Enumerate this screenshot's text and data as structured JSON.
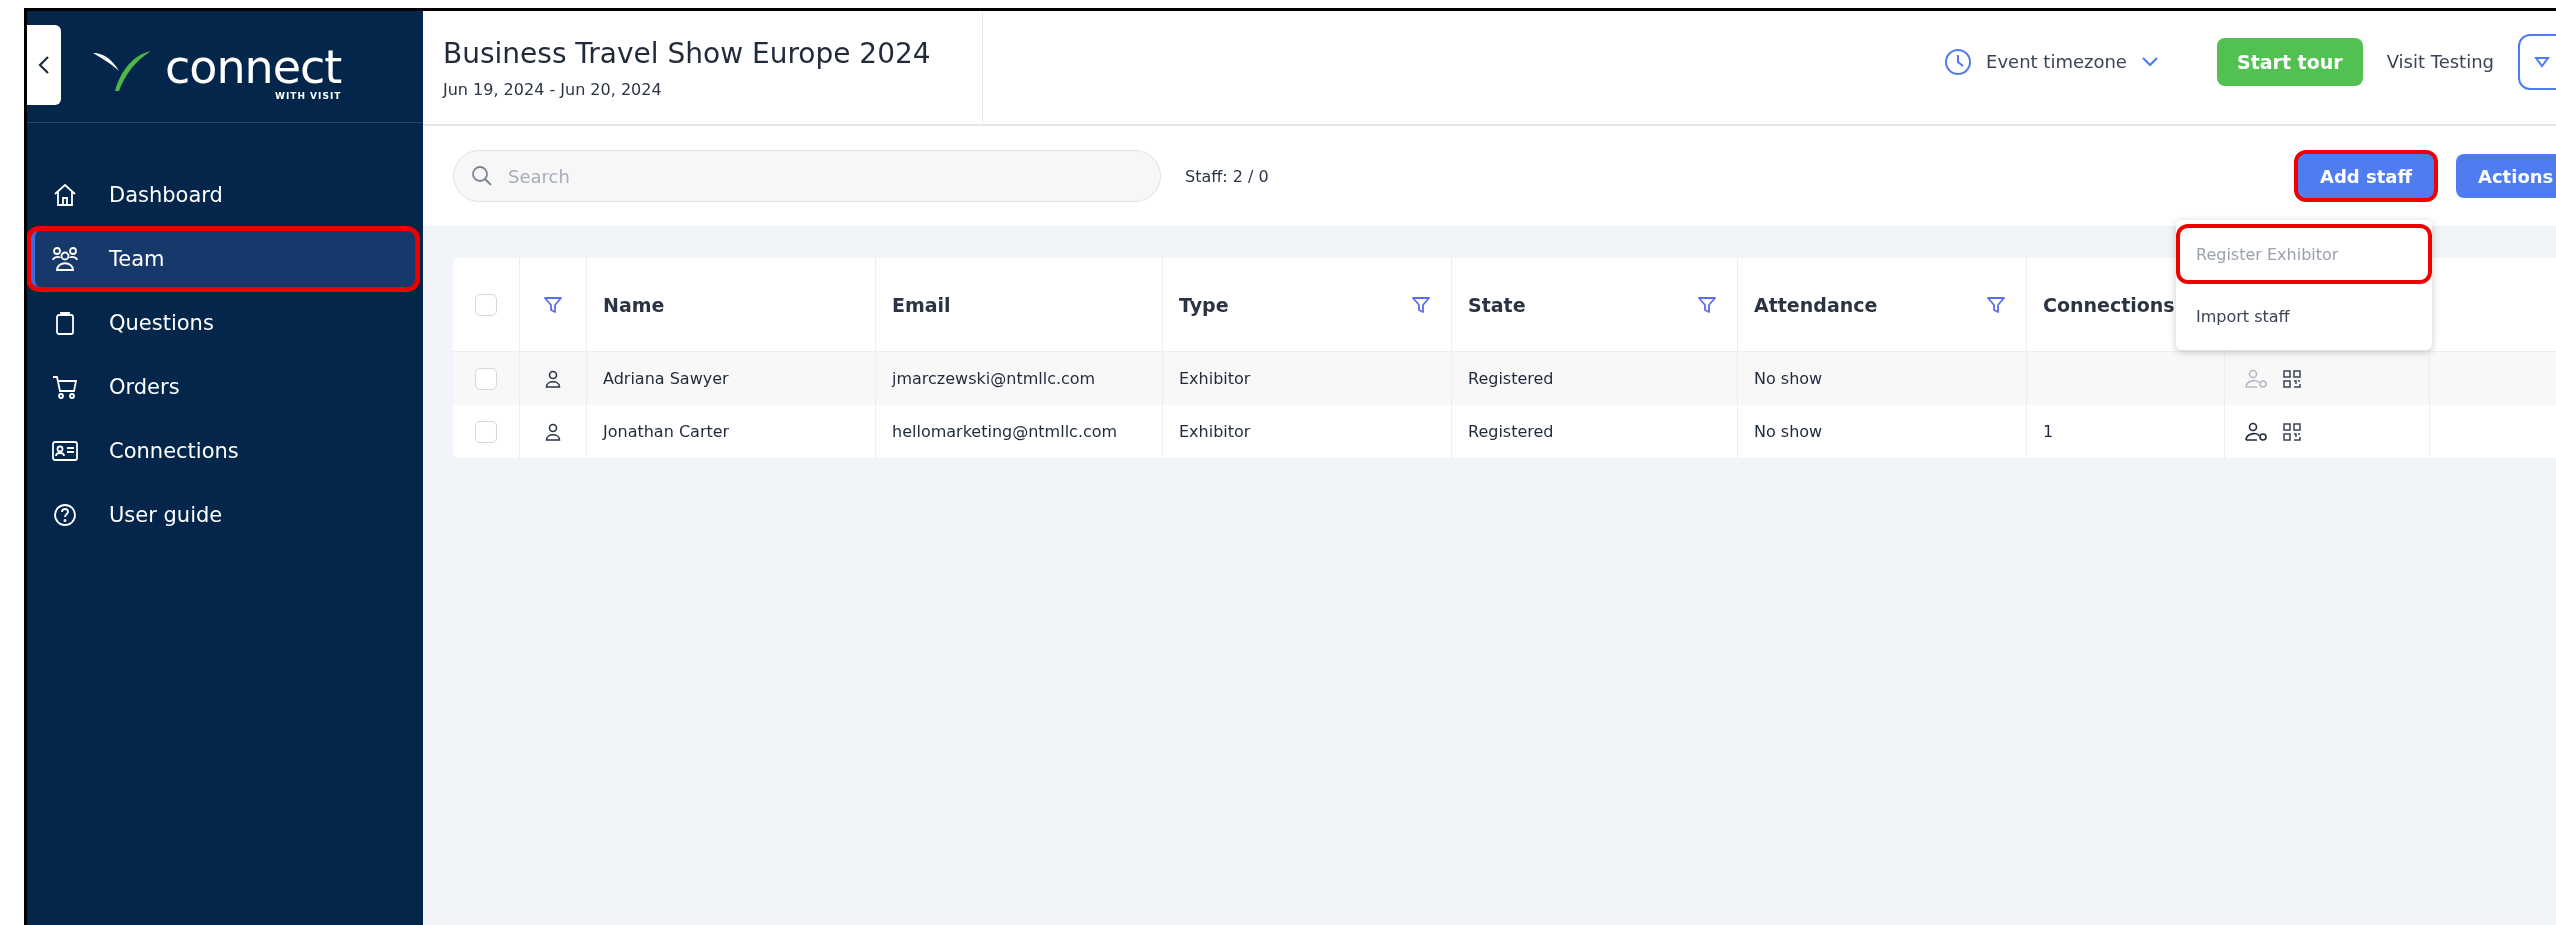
{
  "sidebar": {
    "logo": {
      "wordmark": "connect",
      "tagline": "WITH VISIT"
    },
    "items": [
      {
        "label": "Dashboard",
        "selected": false,
        "highlighted": false
      },
      {
        "label": "Team",
        "selected": true,
        "highlighted": true
      },
      {
        "label": "Questions",
        "selected": false,
        "highlighted": false
      },
      {
        "label": "Orders",
        "selected": false,
        "highlighted": false
      },
      {
        "label": "Connections",
        "selected": false,
        "highlighted": false
      },
      {
        "label": "User guide",
        "selected": false,
        "highlighted": false
      }
    ]
  },
  "header": {
    "title": "Business Travel Show Europe 2024",
    "dates": "Jun 19, 2024 - Jun 20, 2024",
    "timezone": "Event timezone",
    "tour_button": "Start tour",
    "account": "Visit Testing"
  },
  "toolbar": {
    "search": {
      "placeholder": "Search"
    },
    "staff_count": "Staff: 2 / 0",
    "buttons": [
      {
        "label": "Add staff",
        "highlighted": true
      },
      {
        "label": "Actions",
        "highlighted": false
      }
    ]
  },
  "menu": {
    "items": [
      {
        "label": "Register Exhibitor",
        "disabled": true,
        "highlighted": true
      },
      {
        "label": "Import staff",
        "disabled": false,
        "highlighted": false
      }
    ]
  },
  "table": {
    "select_all": {
      "checked": false
    },
    "columns": [
      {
        "label": "Name",
        "filter": false
      },
      {
        "label": "Email",
        "filter": false
      },
      {
        "label": "Type",
        "filter": true
      },
      {
        "label": "State",
        "filter": true
      },
      {
        "label": "Attendance",
        "filter": true
      },
      {
        "label": "Connections",
        "filter": false
      }
    ],
    "rows": [
      {
        "checked": false,
        "name": "Adriana Sawyer",
        "email": "jmarczewski@ntmllc.com",
        "type": "Exhibitor",
        "state": "Registered",
        "attendance": "No show",
        "manage_enabled": false
      },
      {
        "checked": false,
        "name": "Jonathan Carter",
        "email": "hellomarketing@ntmllc.com",
        "type": "Exhibitor",
        "state": "Registered",
        "attendance": "No show",
        "connections": "1",
        "manage_enabled": true
      }
    ]
  }
}
